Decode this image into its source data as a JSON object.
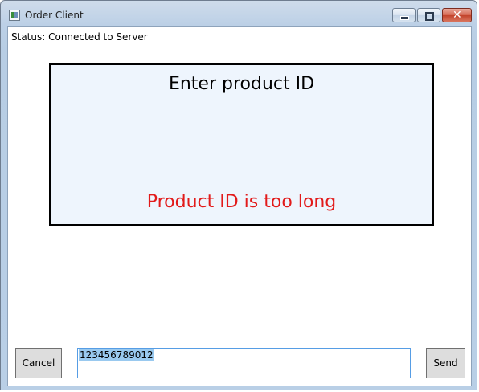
{
  "window": {
    "title": "Order Client",
    "controls": {
      "minimize": "minimize-icon",
      "maximize": "maximize-icon",
      "close": "close-icon"
    }
  },
  "status": {
    "text": "Status: Connected to Server"
  },
  "panel": {
    "title": "Enter product ID",
    "error": "Product ID is too long",
    "error_color": "#e21a1a"
  },
  "footer": {
    "cancel_label": "Cancel",
    "input_value": "123456789012",
    "send_label": "Send"
  }
}
